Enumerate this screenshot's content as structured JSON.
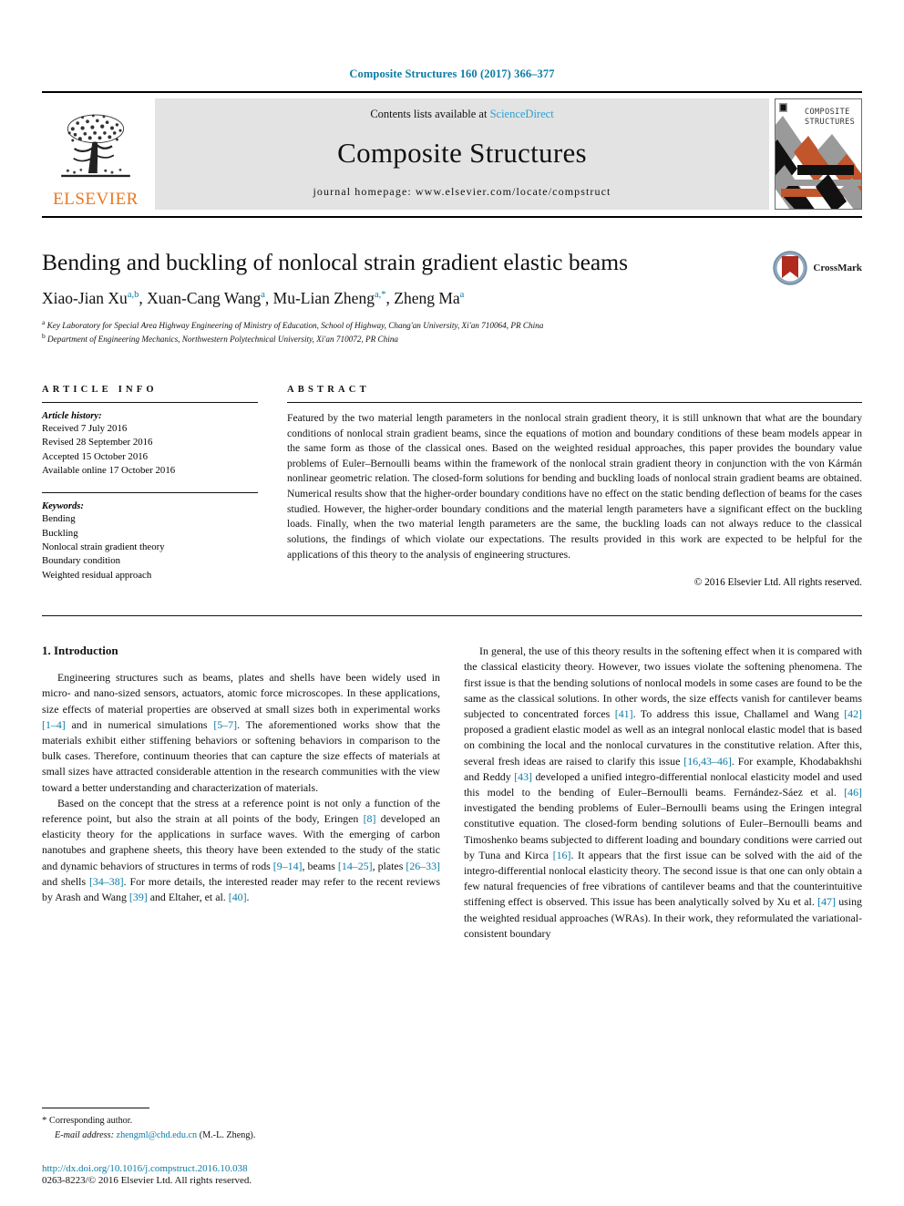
{
  "running_head": "Composite Structures 160 (2017) 366–377",
  "masthead": {
    "publisher_logo_name": "ELSEVIER",
    "contents_prefix": "Contents lists available at ",
    "contents_link": "ScienceDirect",
    "journal_name": "Composite Structures",
    "homepage": "journal homepage: www.elsevier.com/locate/compstruct",
    "cover_line1": "COMPOSITE",
    "cover_line2": "STRUCTURES"
  },
  "article": {
    "title": "Bending and buckling of nonlocal strain gradient elastic beams",
    "authors": [
      {
        "name": "Xiao-Jian Xu",
        "sup": "a,b",
        "sep": ", "
      },
      {
        "name": "Xuan-Cang Wang",
        "sup": "a",
        "sep": ", "
      },
      {
        "name": "Mu-Lian Zheng",
        "sup": "a,*",
        "sep": ", "
      },
      {
        "name": "Zheng Ma",
        "sup": "a",
        "sep": ""
      }
    ],
    "affiliations": [
      {
        "marker": "a",
        "text": "Key Laboratory for Special Area Highway Engineering of Ministry of Education, School of Highway, Chang'an University, Xi'an 710064, PR China"
      },
      {
        "marker": "b",
        "text": "Department of Engineering Mechanics, Northwestern Polytechnical University, Xi'an 710072, PR China"
      }
    ],
    "crossmark_label": "CrossMark"
  },
  "article_info": {
    "heading": "ARTICLE INFO",
    "history_label": "Article history:",
    "history": [
      "Received 7 July 2016",
      "Revised 28 September 2016",
      "Accepted 15 October 2016",
      "Available online 17 October 2016"
    ],
    "keywords_label": "Keywords:",
    "keywords": [
      "Bending",
      "Buckling",
      "Nonlocal strain gradient theory",
      "Boundary condition",
      "Weighted residual approach"
    ]
  },
  "abstract": {
    "heading": "ABSTRACT",
    "text": "Featured by the two material length parameters in the nonlocal strain gradient theory, it is still unknown that what are the boundary conditions of nonlocal strain gradient beams, since the equations of motion and boundary conditions of these beam models appear in the same form as those of the classical ones. Based on the weighted residual approaches, this paper provides the boundary value problems of Euler–Bernoulli beams within the framework of the nonlocal strain gradient theory in conjunction with the von Kármán nonlinear geometric relation. The closed-form solutions for bending and buckling loads of nonlocal strain gradient beams are obtained. Numerical results show that the higher-order boundary conditions have no effect on the static bending deflection of beams for the cases studied. However, the higher-order boundary conditions and the material length parameters have a significant effect on the buckling loads. Finally, when the two material length parameters are the same, the buckling loads can not always reduce to the classical solutions, the findings of which violate our expectations. The results provided in this work are expected to be helpful for the applications of this theory to the analysis of engineering structures.",
    "copyright": "© 2016 Elsevier Ltd. All rights reserved."
  },
  "body": {
    "section_number_title": "1. Introduction",
    "left_paragraphs": [
      "Engineering structures such as beams, plates and shells have been widely used in micro- and nano-sized sensors, actuators, atomic force microscopes. In these applications, size effects of material properties are observed at small sizes both in experimental works [1–4] and in numerical simulations [5–7]. The aforementioned works show that the materials exhibit either stiffening behaviors or softening behaviors in comparison to the bulk cases. Therefore, continuum theories that can capture the size effects of materials at small sizes have attracted considerable attention in the research communities with the view toward a better understanding and characterization of materials.",
      "Based on the concept that the stress at a reference point is not only a function of the reference point, but also the strain at all points of the body, Eringen [8] developed an elasticity theory for the applications in surface waves. With the emerging of carbon nanotubes and graphene sheets, this theory have been extended to the study of the static and dynamic behaviors of structures in terms of rods [9–14], beams [14–25], plates [26–33] and shells [34–38]. For more details, the interested reader may refer to the recent reviews by Arash and Wang [39] and Eltaher, et al. [40]."
    ],
    "right_paragraphs": [
      "In general, the use of this theory results in the softening effect when it is compared with the classical elasticity theory. However, two issues violate the softening phenomena. The first issue is that the bending solutions of nonlocal models in some cases are found to be the same as the classical solutions. In other words, the size effects vanish for cantilever beams subjected to concentrated forces [41]. To address this issue, Challamel and Wang [42] proposed a gradient elastic model as well as an integral nonlocal elastic model that is based on combining the local and the nonlocal curvatures in the constitutive relation. After this, several fresh ideas are raised to clarify this issue [16,43–46]. For example, Khodabakhshi and Reddy [43] developed a unified integro-differential nonlocal elasticity model and used this model to the bending of Euler–Bernoulli beams. Fernández-Sáez et al. [46] investigated the bending problems of Euler–Bernoulli beams using the Eringen integral constitutive equation. The closed-form bending solutions of Euler–Bernoulli beams and Timoshenko beams subjected to different loading and boundary conditions were carried out by Tuna and Kirca [16]. It appears that the first issue can be solved with the aid of the integro-differential nonlocal elasticity theory. The second issue is that one can only obtain a few natural frequencies of free vibrations of cantilever beams and that the counterintuitive stiffening effect is observed. This issue has been analytically solved by Xu et al. [47] using the weighted residual approaches (WRAs). In their work, they reformulated the variational-consistent boundary"
    ]
  },
  "footer": {
    "corresponding_marker": "*",
    "corresponding_text": "Corresponding author.",
    "email_label": "E-mail address:",
    "email": "zhengml@chd.edu.cn",
    "email_owner": "(M.-L. Zheng).",
    "doi": "http://dx.doi.org/10.1016/j.compstruct.2016.10.038",
    "issn": "0263-8223/© 2016 Elsevier Ltd. All rights reserved."
  },
  "colors": {
    "link": "#0b7ba6",
    "sciencedirect": "#2a9fd6",
    "elsevier_orange": "#E87722",
    "cover_orange": "#C1552B",
    "cover_gray": "#9a9a9a",
    "crossmark_red": "#B02A1E",
    "crossmark_blue": "#8fa7bd"
  }
}
